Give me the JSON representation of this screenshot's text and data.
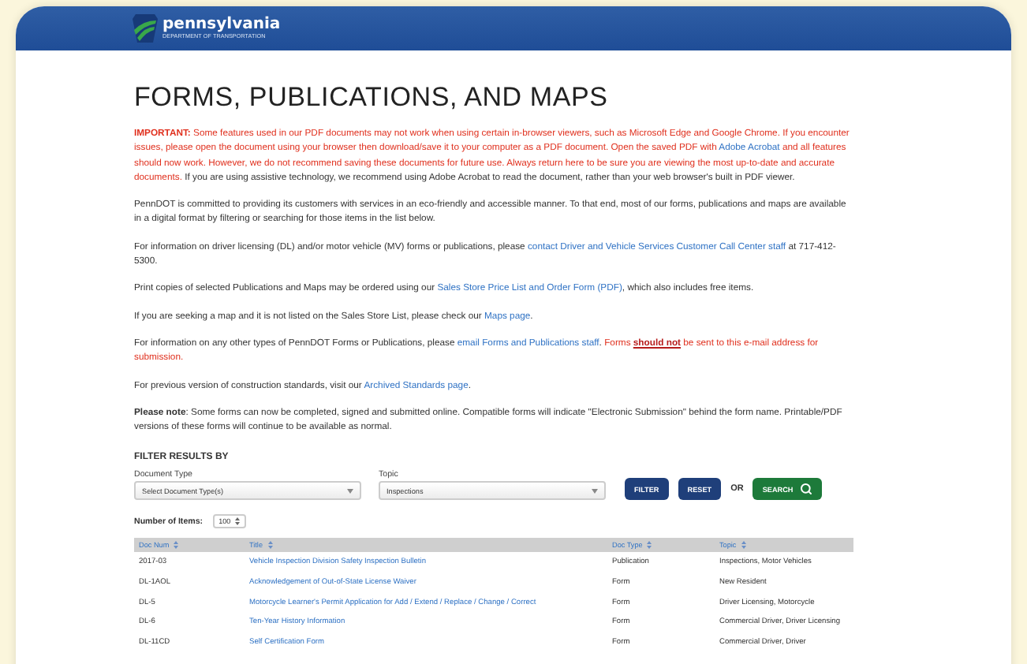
{
  "header": {
    "logo_title": "pennsylvania",
    "logo_subtitle": "DEPARTMENT OF TRANSPORTATION"
  },
  "title": "FORMS, PUBLICATIONS, AND MAPS",
  "paragraphs": [
    {
      "segments": [
        {
          "kind": "alert_bold",
          "text": "IMPORTANT:"
        },
        {
          "kind": "alert",
          "text": " Some features used in our PDF documents may not work when using certain in-browser viewers, such as Microsoft Edge and Google Chrome. If you encounter issues, please open the document using your browser then download/save it to your computer as a PDF document. Open the saved PDF with "
        },
        {
          "kind": "link",
          "text": "Adobe Acrobat"
        },
        {
          "kind": "alert",
          "text": " and all features should now work. However, we do not recommend saving these documents for future use. Always return here to be sure you are viewing the most up-to-date and accurate documents. "
        },
        {
          "kind": "plain",
          "text": " If you are using assistive technology, we recommend using Adobe Acrobat to read the document, rather than your web browser's built in PDF viewer."
        }
      ]
    },
    {
      "segments": [
        {
          "kind": "plain",
          "text": "PennDOT is committed to providing its customers with services in an eco-friendly and accessible manner. To that end, most of our forms, publications and maps are available in a digital format by filtering or searching for those items in the list below."
        }
      ]
    },
    {
      "segments": [
        {
          "kind": "plain",
          "text": "For information on driver licensing (DL) and/or motor vehicle (MV) forms or publications, please "
        },
        {
          "kind": "link",
          "text": "contact Driver and Vehicle Services Customer Call Center staff"
        },
        {
          "kind": "plain",
          "text": " at 717-412-5300."
        }
      ]
    },
    {
      "segments": [
        {
          "kind": "plain",
          "text": "Print copies of selected Publications and Maps may be ordered using our "
        },
        {
          "kind": "link",
          "text": "Sales Store Price List and Order Form (PDF)"
        },
        {
          "kind": "plain",
          "text": ", which also includes free items."
        }
      ]
    },
    {
      "segments": [
        {
          "kind": "plain",
          "text": "If you are seeking a map and it is not listed on the Sales Store List, please check our "
        },
        {
          "kind": "link",
          "text": "Maps page"
        },
        {
          "kind": "plain",
          "text": "."
        }
      ]
    },
    {
      "segments": [
        {
          "kind": "plain",
          "text": "For information on any other types of PennDOT Forms or Publications, please "
        },
        {
          "kind": "link",
          "text": "email Forms and Publications staff"
        },
        {
          "kind": "plain",
          "text": ". "
        },
        {
          "kind": "alert",
          "text": "Forms "
        },
        {
          "kind": "alert_strong",
          "text": "should not"
        },
        {
          "kind": "alert",
          "text": " be sent to this e-mail address for submission."
        }
      ]
    },
    {
      "segments": [
        {
          "kind": "plain",
          "text": "For previous version of construction standards, visit our "
        },
        {
          "kind": "link",
          "text": "Archived Standards page"
        },
        {
          "kind": "plain",
          "text": "."
        }
      ]
    },
    {
      "segments": [
        {
          "kind": "bold",
          "text": "Please note"
        },
        {
          "kind": "plain",
          "text": ": Some forms can now be completed, signed and submitted online. Compatible forms will indicate \"Electronic Submission\" behind the form name. Printable/PDF versions of these forms will continue to be available as normal."
        }
      ]
    }
  ],
  "filter": {
    "heading": "FILTER RESULTS BY",
    "document_type": {
      "label": "Document Type",
      "value": "Select Document Type(s)"
    },
    "topic": {
      "label": "Topic",
      "value": "Inspections"
    },
    "buttons": [
      "FILTER",
      "RESET"
    ],
    "or": "OR",
    "search_button": "SEARCH"
  },
  "items_count": {
    "label": "Number of Items:",
    "value": "100"
  },
  "table": {
    "columns": [
      "Doc Num",
      "Title",
      "Doc Type",
      "Topic"
    ],
    "rows": [
      [
        "2017-03",
        "Vehicle Inspection Division Safety Inspection Bulletin",
        "Publication",
        "Inspections, Motor Vehicles"
      ],
      [
        "DL-1AOL",
        "Acknowledgement of Out-of-State License Waiver",
        "Form",
        "New Resident"
      ],
      [
        "DL-5",
        "Motorcycle Learner's Permit Application for Add / Extend / Replace / Change / Correct",
        "Form",
        "Driver Licensing, Motorcycle"
      ],
      [
        "DL-6",
        "Ten-Year History Information",
        "Form",
        "Commercial Driver, Driver Licensing"
      ],
      [
        "DL-11CD",
        "Self Certification Form",
        "Form",
        "Commercial Driver, Driver"
      ]
    ]
  }
}
